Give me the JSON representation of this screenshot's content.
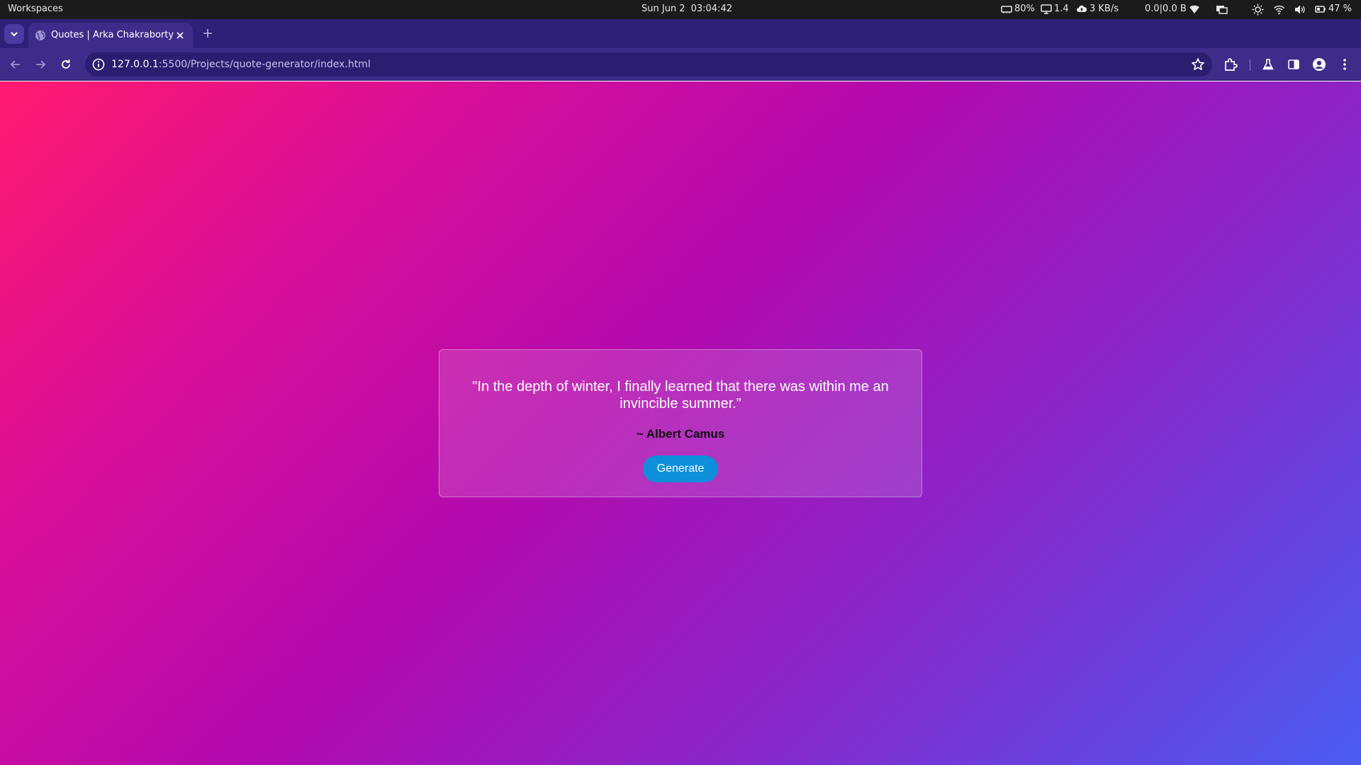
{
  "system_bar": {
    "workspaces": "Workspaces",
    "date": "Sun Jun 2",
    "time": "03:04:42",
    "ram": "80%",
    "cpu": "1.4",
    "net_speed": "3 KB/s",
    "wifi_traffic": "0.0|0.0 B",
    "battery": "47 %"
  },
  "browser": {
    "tab_title": "Quotes | Arka Chakraborty",
    "url_host": "127.0.0.1",
    "url_rest": ":5500/Projects/quote-generator/index.html"
  },
  "page": {
    "quote": "\"In the depth of winter, I finally learned that there was within me an invincible summer.\"",
    "author": "~ Albert Camus",
    "generate_label": "Generate"
  },
  "colors": {
    "gradient_start": "#ff1a6e",
    "gradient_mid": "#b30aae",
    "gradient_end": "#4a5cf0",
    "button_bg": "#0d8fd9",
    "tab_strip_bg": "#2e1f78",
    "toolbar_bg": "#3d2c8a"
  }
}
